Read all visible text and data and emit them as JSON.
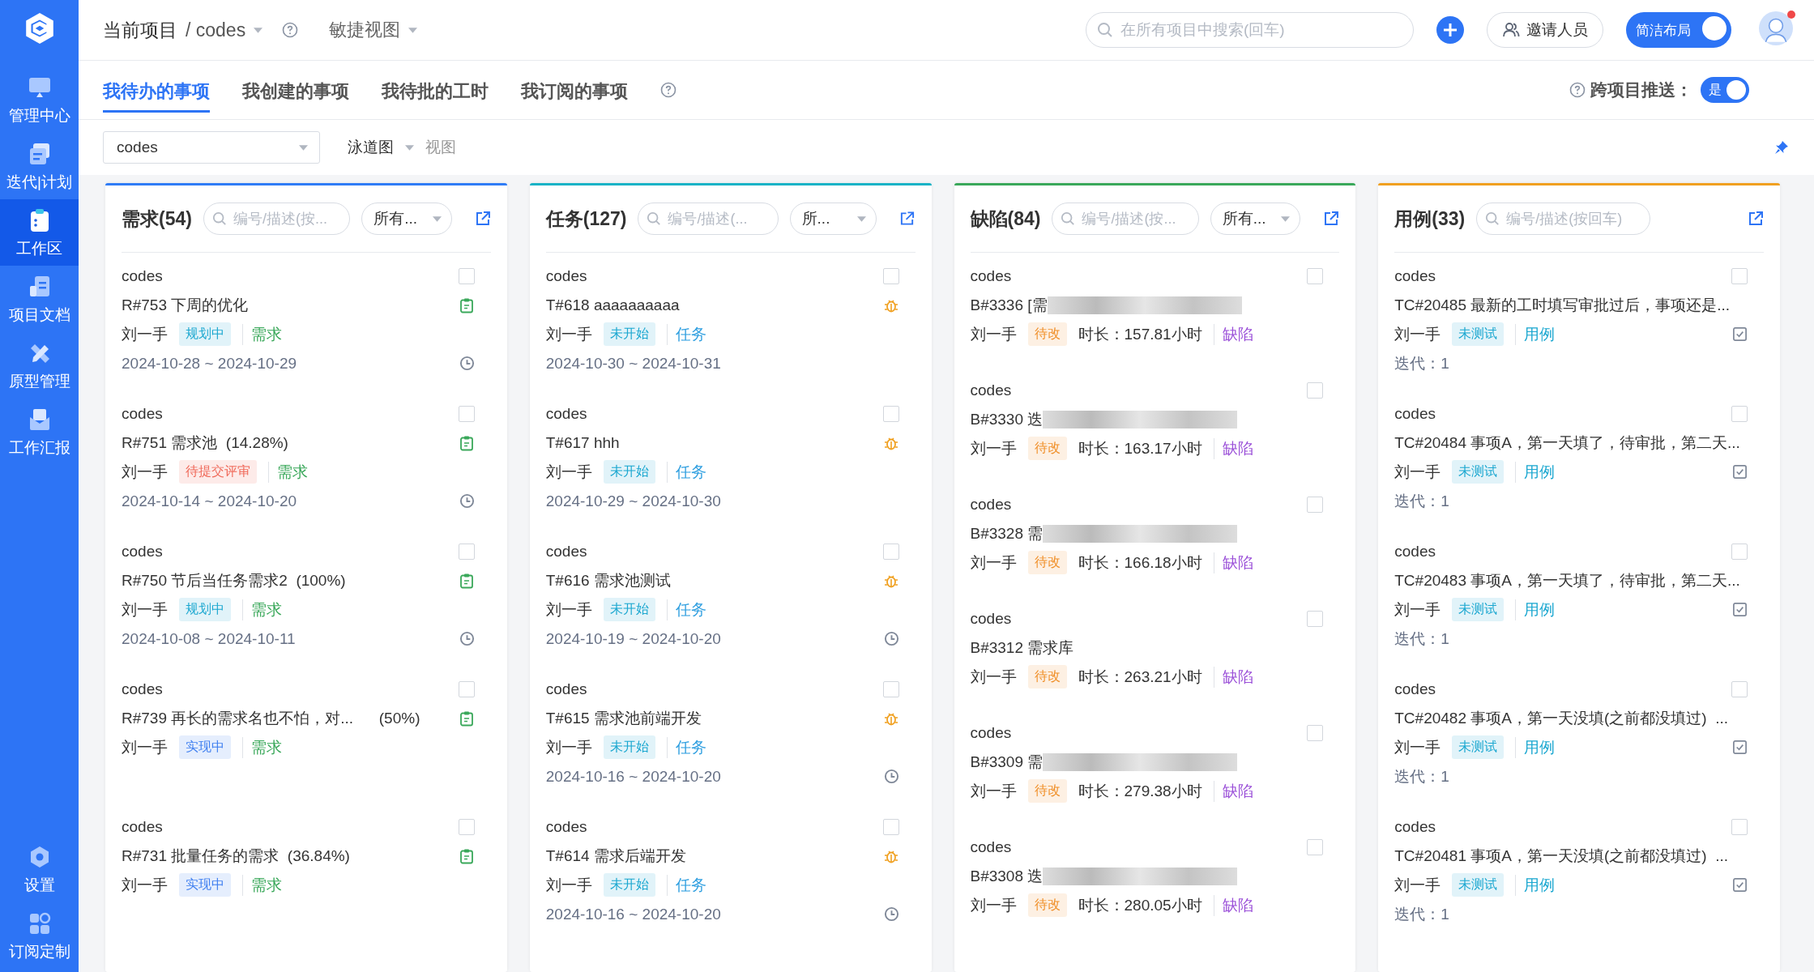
{
  "sidebar": {
    "items": [
      {
        "label": "管理中心",
        "selected": false
      },
      {
        "label": "迭代|计划",
        "selected": false
      },
      {
        "label": "工作区",
        "selected": true
      },
      {
        "label": "项目文档",
        "selected": false
      },
      {
        "label": "原型管理",
        "selected": false
      },
      {
        "label": "工作汇报",
        "selected": false
      }
    ],
    "bottom_items": [
      {
        "label": "设置",
        "selected": false
      },
      {
        "label": "订阅定制",
        "selected": false
      }
    ]
  },
  "header": {
    "breadcrumb": "当前项目",
    "project": "/ codes",
    "view": "敏捷视图",
    "search": {
      "placeholder": "在所有项目中搜索(回车)"
    },
    "invite": "邀请人员",
    "layout_toggle": {
      "label": "简洁布局",
      "on": true
    },
    "notification": true
  },
  "tabs": [
    {
      "label": "我待办的事项",
      "selected": true
    },
    {
      "label": "我创建的事项",
      "selected": false
    },
    {
      "label": "我待批的工时",
      "selected": false
    },
    {
      "label": "我订阅的事项",
      "selected": false
    }
  ],
  "cross_push": {
    "label": "跨项目推送：",
    "toggle_text": "是",
    "on": true
  },
  "filters": {
    "project": "codes",
    "mode": "泳道图",
    "view": "视图"
  },
  "columns": [
    {
      "kind": "requirement",
      "title": "需求(54)",
      "color": "#2f7cf6",
      "search": {
        "placeholder": "编号/描述(按..."
      },
      "filter": "所有...",
      "items": [
        {
          "project": "codes",
          "checked": false,
          "title": "R#753 下周的优化",
          "assignee": "刘一手",
          "status": {
            "label": "规划中",
            "color": "#1ba7d0"
          },
          "type": {
            "label": "需求",
            "color": "#3aa85a"
          },
          "date": "2024-10-28 ~ 2024-10-29",
          "clock": true
        },
        {
          "project": "codes",
          "checked": false,
          "title": "R#751 需求池  (14.28%)",
          "assignee": "刘一手",
          "status": {
            "label": "待提交评审",
            "color": "#f06a5a"
          },
          "type": {
            "label": "需求",
            "color": "#3aa85a"
          },
          "date": "2024-10-14 ~ 2024-10-20",
          "clock": true
        },
        {
          "project": "codes",
          "checked": false,
          "title": "R#750 节后当任务需求2  (100%)",
          "assignee": "刘一手",
          "status": {
            "label": "规划中",
            "color": "#1ba7d0"
          },
          "type": {
            "label": "需求",
            "color": "#3aa85a"
          },
          "date": "2024-10-08 ~ 2024-10-11",
          "clock": true
        },
        {
          "project": "codes",
          "checked": false,
          "title": "R#739 再长的需求名也不怕，对...      (50%)",
          "assignee": "刘一手",
          "status": {
            "label": "实现中",
            "color": "#3d7ef0"
          },
          "type": {
            "label": "需求",
            "color": "#3aa85a"
          },
          "clock": false
        },
        {
          "project": "codes",
          "checked": false,
          "title": "R#731 批量任务的需求  (36.84%)",
          "assignee": "刘一手",
          "status": {
            "label": "实现中",
            "color": "#3d7ef0"
          },
          "type": {
            "label": "需求",
            "color": "#3aa85a"
          },
          "clock": false
        }
      ]
    },
    {
      "kind": "task",
      "title": "任务(127)",
      "color": "#19b3c6",
      "search": {
        "placeholder": "编号/描述(..."
      },
      "filter": "所...",
      "items": [
        {
          "project": "codes",
          "checked": false,
          "title": "T#618 aaaaaaaaaa",
          "assignee": "刘一手",
          "status": {
            "label": "未开始",
            "color": "#1ba7d0"
          },
          "type": {
            "label": "任务",
            "color": "#2f9fe0"
          },
          "date": "2024-10-30 ~ 2024-10-31",
          "clock": false
        },
        {
          "project": "codes",
          "checked": false,
          "title": "T#617 hhh",
          "assignee": "刘一手",
          "status": {
            "label": "未开始",
            "color": "#1ba7d0"
          },
          "type": {
            "label": "任务",
            "color": "#2f9fe0"
          },
          "date": "2024-10-29 ~ 2024-10-30",
          "clock": false
        },
        {
          "project": "codes",
          "checked": false,
          "title": "T#616 需求池测试",
          "assignee": "刘一手",
          "status": {
            "label": "未开始",
            "color": "#1ba7d0"
          },
          "type": {
            "label": "任务",
            "color": "#2f9fe0"
          },
          "date": "2024-10-19 ~ 2024-10-20",
          "clock": true
        },
        {
          "project": "codes",
          "checked": false,
          "title": "T#615 需求池前端开发",
          "assignee": "刘一手",
          "status": {
            "label": "未开始",
            "color": "#1ba7d0"
          },
          "type": {
            "label": "任务",
            "color": "#2f9fe0"
          },
          "date": "2024-10-16 ~ 2024-10-20",
          "clock": true
        },
        {
          "project": "codes",
          "checked": false,
          "title": "T#614 需求后端开发",
          "assignee": "刘一手",
          "status": {
            "label": "未开始",
            "color": "#1ba7d0"
          },
          "type": {
            "label": "任务",
            "color": "#2f9fe0"
          },
          "date": "2024-10-16 ~ 2024-10-20",
          "clock": true
        }
      ]
    },
    {
      "kind": "defect",
      "title": "缺陷(84)",
      "color": "#3aa85a",
      "search": {
        "placeholder": "编号/描述(按..."
      },
      "filter": "所有...",
      "items": [
        {
          "project": "codes",
          "checked": false,
          "title": "B#3336 [需",
          "blurred": true,
          "assignee": "刘一手",
          "status": {
            "label": "待改",
            "color": "#f0902a"
          },
          "type": {
            "label": "缺陷",
            "color": "#9a4fd8"
          },
          "duration": "时长：157.81小时"
        },
        {
          "project": "codes",
          "checked": false,
          "title": "B#3330 迭",
          "blurred": true,
          "assignee": "刘一手",
          "status": {
            "label": "待改",
            "color": "#f0902a"
          },
          "type": {
            "label": "缺陷",
            "color": "#9a4fd8"
          },
          "duration": "时长：163.17小时"
        },
        {
          "project": "codes",
          "checked": false,
          "title": "B#3328 需",
          "blurred": true,
          "assignee": "刘一手",
          "status": {
            "label": "待改",
            "color": "#f0902a"
          },
          "type": {
            "label": "缺陷",
            "color": "#9a4fd8"
          },
          "duration": "时长：166.18小时"
        },
        {
          "project": "codes",
          "checked": false,
          "title": "B#3312 需求库",
          "blurred": false,
          "assignee": "刘一手",
          "status": {
            "label": "待改",
            "color": "#f0902a"
          },
          "type": {
            "label": "缺陷",
            "color": "#9a4fd8"
          },
          "duration": "时长：263.21小时"
        },
        {
          "project": "codes",
          "checked": false,
          "title": "B#3309 需",
          "blurred": true,
          "assignee": "刘一手",
          "status": {
            "label": "待改",
            "color": "#f0902a"
          },
          "type": {
            "label": "缺陷",
            "color": "#9a4fd8"
          },
          "duration": "时长：279.38小时"
        },
        {
          "project": "codes",
          "checked": false,
          "title": "B#3308 迭",
          "blurred": true,
          "assignee": "刘一手",
          "status": {
            "label": "待改",
            "color": "#f0902a"
          },
          "type": {
            "label": "缺陷",
            "color": "#9a4fd8"
          },
          "duration": "时长：280.05小时"
        }
      ]
    },
    {
      "kind": "case",
      "title": "用例(33)",
      "color": "#f0a020",
      "search": {
        "placeholder": "编号/描述(按回车)"
      },
      "items": [
        {
          "project": "codes",
          "checked": false,
          "title": "TC#20485 最新的工时填写审批过后，事项还是...",
          "assignee": "刘一手",
          "status": {
            "label": "未测试",
            "color": "#1ba7d0"
          },
          "type": {
            "label": "用例",
            "color": "#1ba7d0"
          },
          "iteration": "迭代：1"
        },
        {
          "project": "codes",
          "checked": false,
          "title": "TC#20484 事项A，第一天填了，待审批，第二天...",
          "assignee": "刘一手",
          "status": {
            "label": "未测试",
            "color": "#1ba7d0"
          },
          "type": {
            "label": "用例",
            "color": "#1ba7d0"
          },
          "iteration": "迭代：1"
        },
        {
          "project": "codes",
          "checked": false,
          "title": "TC#20483 事项A，第一天填了，待审批，第二天...",
          "assignee": "刘一手",
          "status": {
            "label": "未测试",
            "color": "#1ba7d0"
          },
          "type": {
            "label": "用例",
            "color": "#1ba7d0"
          },
          "iteration": "迭代：1"
        },
        {
          "project": "codes",
          "checked": false,
          "title": "TC#20482 事项A，第一天没填(之前都没填过)  ...",
          "assignee": "刘一手",
          "status": {
            "label": "未测试",
            "color": "#1ba7d0"
          },
          "type": {
            "label": "用例",
            "color": "#1ba7d0"
          },
          "iteration": "迭代：1"
        },
        {
          "project": "codes",
          "checked": false,
          "title": "TC#20481 事项A，第一天没填(之前都没填过)  ...",
          "assignee": "刘一手",
          "status": {
            "label": "未测试",
            "color": "#1ba7d0"
          },
          "type": {
            "label": "用例",
            "color": "#1ba7d0"
          },
          "iteration": "迭代：1"
        }
      ]
    }
  ]
}
